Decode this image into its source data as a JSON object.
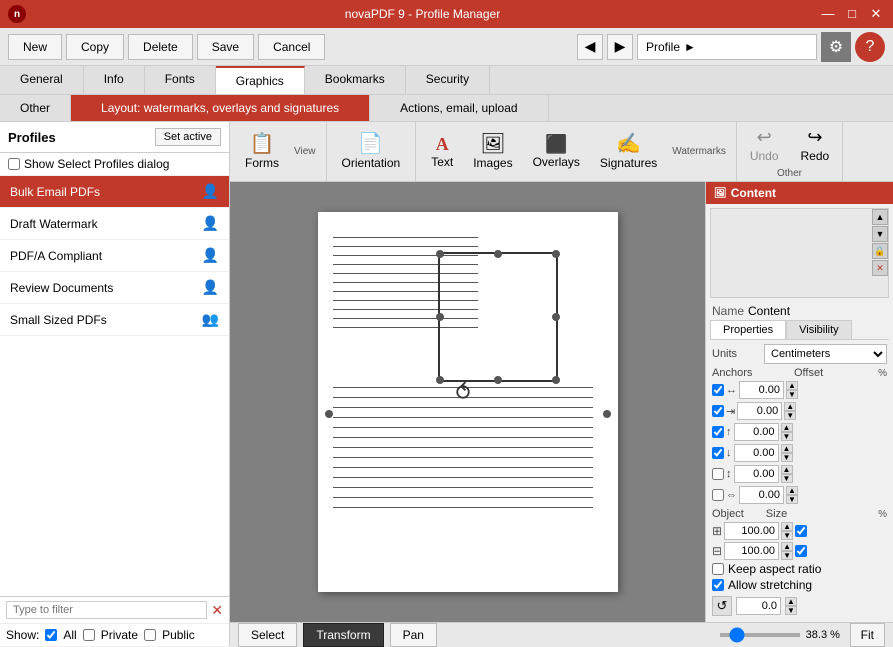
{
  "titlebar": {
    "title": "novaPDF 9 - Profile Manager",
    "minimize": "—",
    "maximize": "□",
    "close": "✕"
  },
  "toolbar": {
    "new_label": "New",
    "copy_label": "Copy",
    "delete_label": "Delete",
    "save_label": "Save",
    "cancel_label": "Cancel",
    "back_icon": "◀",
    "forward_icon": "▶",
    "profile_label": "Profile",
    "profile_arrow": "▶"
  },
  "tabs_row1": {
    "items": [
      {
        "label": "General",
        "active": false
      },
      {
        "label": "Info",
        "active": false
      },
      {
        "label": "Fonts",
        "active": false
      },
      {
        "label": "Graphics",
        "active": true
      },
      {
        "label": "Bookmarks",
        "active": false
      },
      {
        "label": "Security",
        "active": false
      }
    ]
  },
  "tabs_row2": {
    "items": [
      {
        "label": "Other",
        "active": false
      },
      {
        "label": "Layout: watermarks, overlays and signatures",
        "active": true
      },
      {
        "label": "Actions, email, upload",
        "active": false
      }
    ]
  },
  "inner_toolbar": {
    "groups": [
      {
        "label": "View",
        "items": [
          {
            "icon": "📋",
            "label": "Forms"
          }
        ]
      },
      {
        "label": "",
        "items": [
          {
            "icon": "📄",
            "label": "Orientation"
          }
        ]
      },
      {
        "label": "Watermarks",
        "items": [
          {
            "icon": "A",
            "label": "Text"
          },
          {
            "icon": "🖼",
            "label": "Images"
          },
          {
            "icon": "⬛",
            "label": "Overlays"
          },
          {
            "icon": "✍",
            "label": "Signatures"
          }
        ]
      },
      {
        "label": "Other",
        "items": [
          {
            "icon": "↩",
            "label": "Undo"
          },
          {
            "icon": "↪",
            "label": "Redo"
          }
        ]
      }
    ],
    "undo_label": "Undo",
    "redo_label": "Redo"
  },
  "sidebar": {
    "title": "Profiles",
    "set_active_label": "Set active",
    "show_profiles_label": "Show Select Profiles dialog",
    "filter_placeholder": "Type to filter",
    "show_label": "Show:",
    "all_label": "All",
    "private_label": "Private",
    "public_label": "Public",
    "profiles": [
      {
        "name": "Bulk Email PDFs",
        "icon": "👤",
        "active": true
      },
      {
        "name": "Draft Watermark",
        "icon": "👤",
        "active": false
      },
      {
        "name": "PDF/A Compliant",
        "icon": "👤",
        "active": false
      },
      {
        "name": "Review Documents",
        "icon": "👤",
        "active": false
      },
      {
        "name": "Small Sized PDFs",
        "icon": "👥",
        "active": false
      }
    ]
  },
  "right_panel": {
    "content_label": "Content",
    "name_label": "Name",
    "name_value": "Content",
    "tabs": [
      "Properties",
      "Visibility"
    ],
    "active_tab": "Properties",
    "units_label": "Units",
    "units_value": "Centimeters",
    "anchors_label": "Anchors",
    "offset_label": "Offset",
    "pct_label": "%",
    "anchor_rows": [
      {
        "checked": true,
        "icon": "↔",
        "val": "0.00"
      },
      {
        "checked": true,
        "icon": "⇥",
        "val": "0.00"
      },
      {
        "checked": true,
        "icon": "↑",
        "val": "0.00"
      },
      {
        "checked": true,
        "icon": "↓",
        "val": "0.00"
      },
      {
        "checked": false,
        "icon": "↕",
        "val": "0.00"
      },
      {
        "checked": false,
        "icon": "⇔",
        "val": "0.00"
      }
    ],
    "object_label": "Object",
    "size_label": "Size",
    "size_w": "100.00",
    "size_h": "100.00",
    "keep_aspect_label": "Keep aspect ratio",
    "allow_stretch_label": "Allow stretching",
    "rotate_val": "0.0"
  },
  "bottom": {
    "select_label": "Select",
    "transform_label": "Transform",
    "pan_label": "Pan",
    "zoom_pct": "38.3 %",
    "fit_label": "Fit"
  }
}
